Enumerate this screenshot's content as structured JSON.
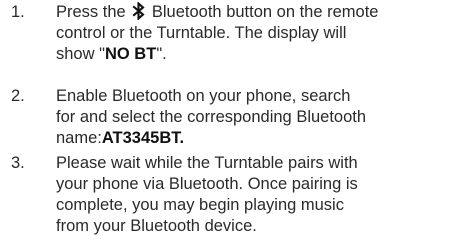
{
  "steps": [
    {
      "number": "1.",
      "line1_before": "Press the ",
      "icon": "bluetooth-icon",
      "line1_after": " Bluetooth button on the remote",
      "line2": "control or the Turntable. The display will",
      "line3_prefix": "show \"",
      "line3_bold": "NO BT",
      "line3_suffix": "\"."
    },
    {
      "number": "2.",
      "line1": "Enable Bluetooth on your phone, search",
      "line2": "for and select the corresponding Bluetooth",
      "line3_prefix": "name:",
      "line3_bold": "AT3345BT."
    },
    {
      "number": "3.",
      "line1": "Please wait while the Turntable pairs with",
      "line2": "your phone via Bluetooth. Once pairing is",
      "line3": "complete, you may begin playing music",
      "line4": "from your Bluetooth device."
    }
  ],
  "colors": {
    "text": "#2a2a2a",
    "bold_text": "#111111"
  }
}
